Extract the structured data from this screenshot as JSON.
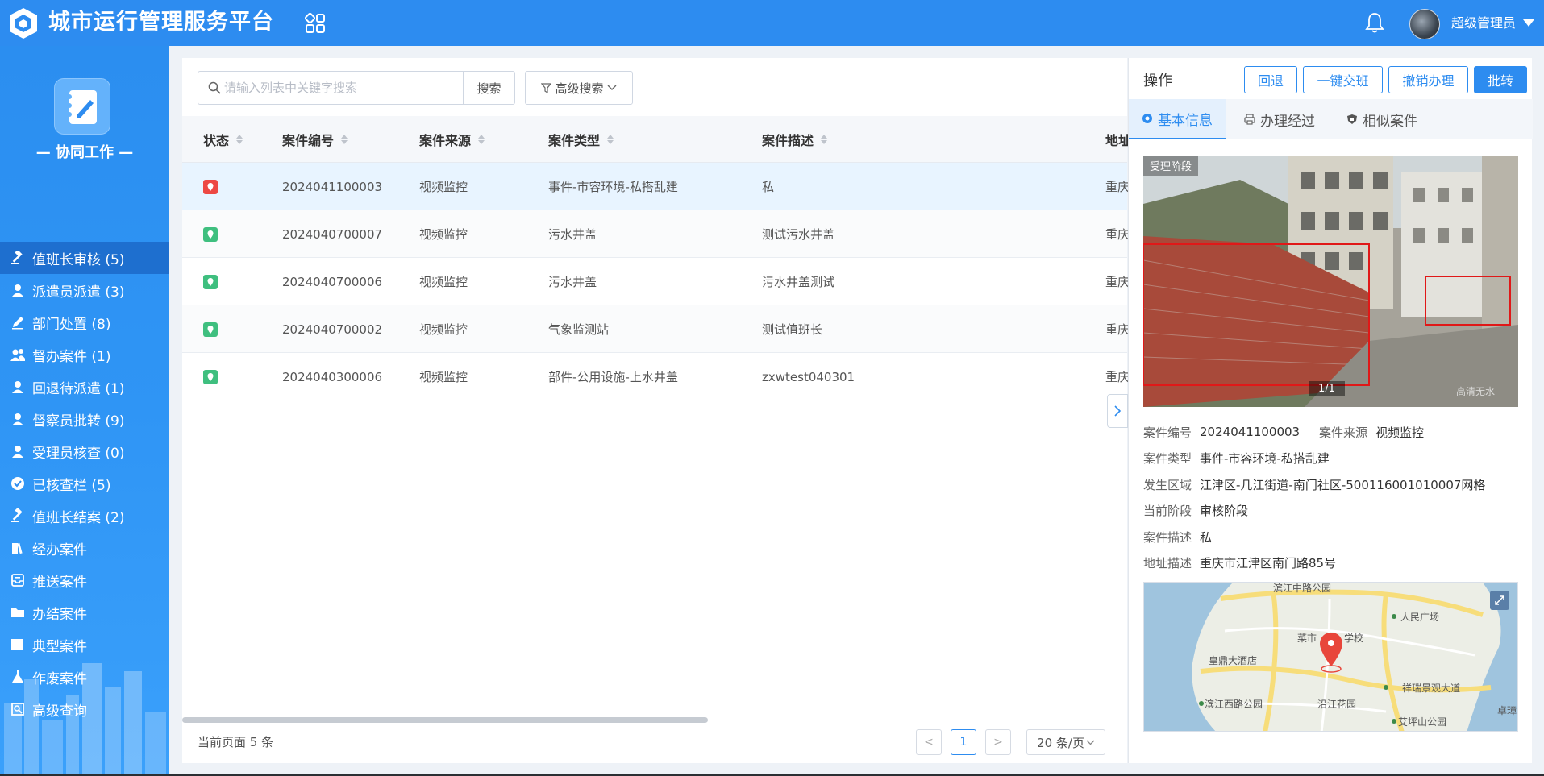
{
  "app": {
    "title": "城市运行管理服务平台"
  },
  "header": {
    "username": "超级管理员"
  },
  "sidebar": {
    "section_title": "— 协同工作 —",
    "items": [
      {
        "label": "值班长审核 (5)",
        "icon": "gavel-icon"
      },
      {
        "label": "派遣员派遣 (3)",
        "icon": "user-icon"
      },
      {
        "label": "部门处置 (8)",
        "icon": "pen-icon"
      },
      {
        "label": "督办案件 (1)",
        "icon": "users-icon"
      },
      {
        "label": "回退待派遣 (1)",
        "icon": "user-icon"
      },
      {
        "label": "督察员批转 (9)",
        "icon": "user-icon"
      },
      {
        "label": "受理员核查 (0)",
        "icon": "user-icon"
      },
      {
        "label": "已核查栏 (5)",
        "icon": "check-circle-icon"
      },
      {
        "label": "值班长结案 (2)",
        "icon": "gavel-icon"
      },
      {
        "label": "经办案件",
        "icon": "books-icon"
      },
      {
        "label": "推送案件",
        "icon": "inbox-icon"
      },
      {
        "label": "办结案件",
        "icon": "folder-icon"
      },
      {
        "label": "典型案件",
        "icon": "library-icon"
      },
      {
        "label": "作废案件",
        "icon": "scale-icon"
      },
      {
        "label": "高级查询",
        "icon": "query-icon"
      }
    ]
  },
  "search": {
    "placeholder": "请输入列表中关键字搜索",
    "value": "",
    "button": "搜索",
    "advanced": "高级搜索"
  },
  "table": {
    "columns": [
      "状态",
      "案件编号",
      "案件来源",
      "案件类型",
      "案件描述",
      "地址"
    ],
    "rows": [
      {
        "status": "red",
        "code": "2024041100003",
        "source": "视频监控",
        "type": "事件-市容环境-私搭乱建",
        "desc": "私",
        "addr": "重庆"
      },
      {
        "status": "green",
        "code": "2024040700007",
        "source": "视频监控",
        "type": "污水井盖",
        "desc": "测试污水井盖",
        "addr": "重庆"
      },
      {
        "status": "green",
        "code": "2024040700006",
        "source": "视频监控",
        "type": "污水井盖",
        "desc": "污水井盖测试",
        "addr": "重庆"
      },
      {
        "status": "green",
        "code": "2024040700002",
        "source": "视频监控",
        "type": "气象监测站",
        "desc": "测试值班长",
        "addr": "重庆"
      },
      {
        "status": "green",
        "code": "2024040300006",
        "source": "视频监控",
        "type": "部件-公用设施-上水井盖",
        "desc": "zxwtest040301",
        "addr": "重庆"
      }
    ]
  },
  "footer": {
    "count": "当前页面 5 条",
    "prev": "<",
    "page": "1",
    "next": ">",
    "page_size": "20 条/页"
  },
  "detail": {
    "ops_label": "操作",
    "buttons": [
      "回退",
      "一键交班",
      "撤销办理",
      "批转"
    ],
    "tabs": [
      "基本信息",
      "办理经过",
      "相似案件"
    ],
    "photo_stage": "受理阶段",
    "photo_counter": "1/1",
    "photo_watermark": "高清无水",
    "info": {
      "code_key": "案件编号",
      "code_val": "2024041100003",
      "source_key": "案件来源",
      "source_val": "视频监控",
      "type_key": "案件类型",
      "type_val": "事件-市容环境-私搭乱建",
      "area_key": "发生区域",
      "area_val": "江津区-几江街道-南门社区-500116001010007网格",
      "stage_key": "当前阶段",
      "stage_val": "审核阶段",
      "desc_key": "案件描述",
      "desc_val": "私",
      "addr_key": "地址描述",
      "addr_val": "重庆市江津区南门路85号"
    },
    "map_labels": [
      "滨江中路公园",
      "人民广场",
      "菜市",
      "学校",
      "皇鼎大酒店",
      "祥瑞景观大道",
      "滨江西路公园",
      "沿江花园",
      "艾坪山公园",
      "卓璋"
    ]
  },
  "colors": {
    "primary": "#2d8cf0",
    "sidebar_active": "#1e6fcf",
    "status_red": "#ed4843",
    "status_green": "#3fbf7f"
  }
}
